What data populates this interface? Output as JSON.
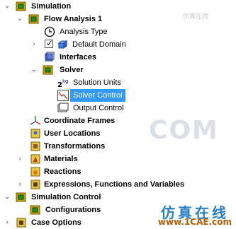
{
  "tree": {
    "simulation": "Simulation",
    "flow_analysis": "Flow Analysis 1",
    "analysis_type": "Analysis Type",
    "default_domain": "Default Domain",
    "interfaces": "Interfaces",
    "solver": "Solver",
    "solution_units": "Solution Units",
    "solver_control": "Solver Control",
    "output_control": "Output Control",
    "coordinate_frames": "Coordinate Frames",
    "user_locations": "User Locations",
    "transformations": "Transformations",
    "materials": "Materials",
    "reactions": "Reactions",
    "expressions": "Expressions, Functions and Variables",
    "simulation_control": "Simulation Control",
    "configurations": "Configurations",
    "case_options": "Case Options"
  },
  "watermark": {
    "big": "COM",
    "small": "仿真在线",
    "cn": "仿真在线",
    "url": "www.1CAE.com"
  }
}
